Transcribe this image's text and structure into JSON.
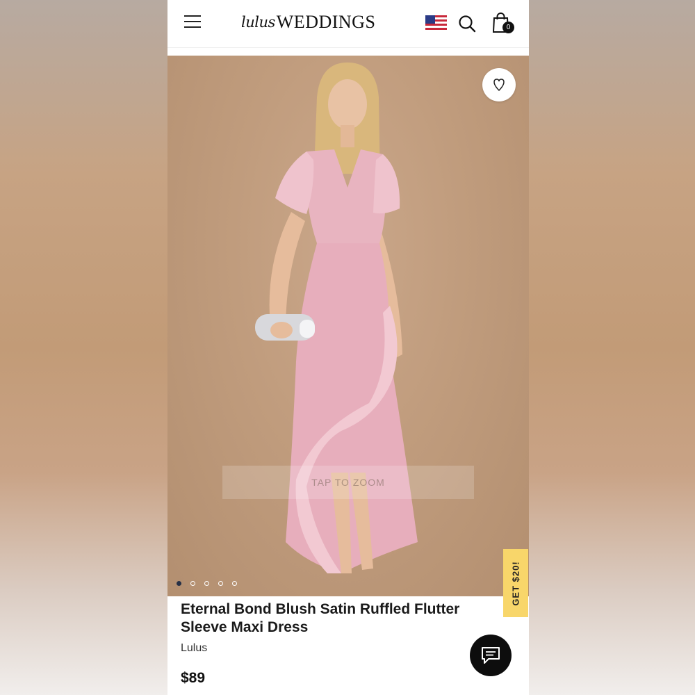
{
  "header": {
    "logo_script": "lulus",
    "logo_main": "WEDDINGS",
    "cart_count": "0",
    "icons": [
      "menu-icon",
      "us-flag-icon",
      "search-icon",
      "shopping-bag-icon"
    ]
  },
  "hero": {
    "zoom_label": "TAP TO ZOOM",
    "image_count": 5,
    "active_image": 1,
    "wishlist_icon": "heart-icon"
  },
  "promo": {
    "label": "GET $20!",
    "color": "#f8d66a"
  },
  "product": {
    "title": "Eternal Bond Blush Satin Ruffled Flutter Sleeve Maxi Dress",
    "brand": "Lulus",
    "price": "$89"
  },
  "chat": {
    "icon": "chat-bubble-icon"
  },
  "colors": {
    "dress": "#e8b4c0",
    "background": "#c4a183",
    "active_dot": "#263046"
  }
}
